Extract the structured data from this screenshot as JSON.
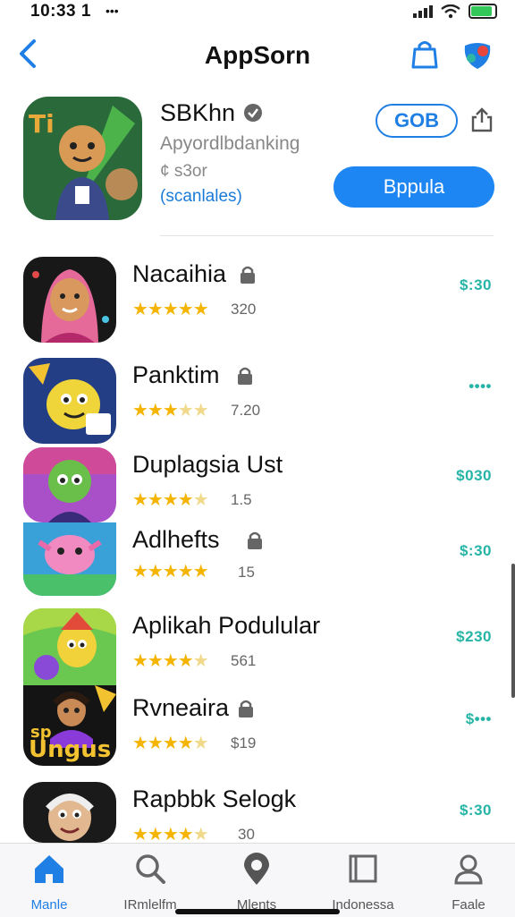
{
  "status_bar": {
    "time": "10:33 1",
    "left_icons": "•••"
  },
  "header": {
    "title": "AppSorn"
  },
  "featured": {
    "name": "SBKhn",
    "subtitle": "Apyordlbdanking",
    "meta": "¢ s3or",
    "link": "(scanlales)",
    "get_label": "GOB",
    "primary_label": "Bppula"
  },
  "apps": [
    {
      "name": "Nacaihia",
      "rating": "320",
      "price": "$:30",
      "stars": 5
    },
    {
      "name": "Panktim",
      "rating": "7.20",
      "price": "••••",
      "stars": 3.5
    },
    {
      "name": "Duplagsia Ust",
      "rating": "1.5",
      "price": "$030",
      "stars": 4.5
    },
    {
      "name": "Adlhefts",
      "rating": "15",
      "price": "$:30",
      "stars": 5
    },
    {
      "name": "Aplikah Podulular",
      "rating": "561",
      "price": "$230",
      "stars": 4
    },
    {
      "name": "Rvneaira",
      "rating": "$19",
      "price": "$•••",
      "stars": 4.5
    },
    {
      "name": "Rapbbk Selogk",
      "rating": "30",
      "price": "$:30",
      "stars": 4
    }
  ],
  "tabs": [
    {
      "label": "Manle",
      "icon": "home-icon",
      "active": true
    },
    {
      "label": "IRmlelfm",
      "icon": "search-icon",
      "active": false
    },
    {
      "label": "Mlents",
      "icon": "pin-icon",
      "active": false
    },
    {
      "label": "Indonessa",
      "icon": "book-icon",
      "active": false
    },
    {
      "label": "Faale",
      "icon": "profile-icon",
      "active": false
    }
  ],
  "colors": {
    "accent": "#1e86f2",
    "price": "#25b4a6",
    "star": "#f4b400"
  }
}
